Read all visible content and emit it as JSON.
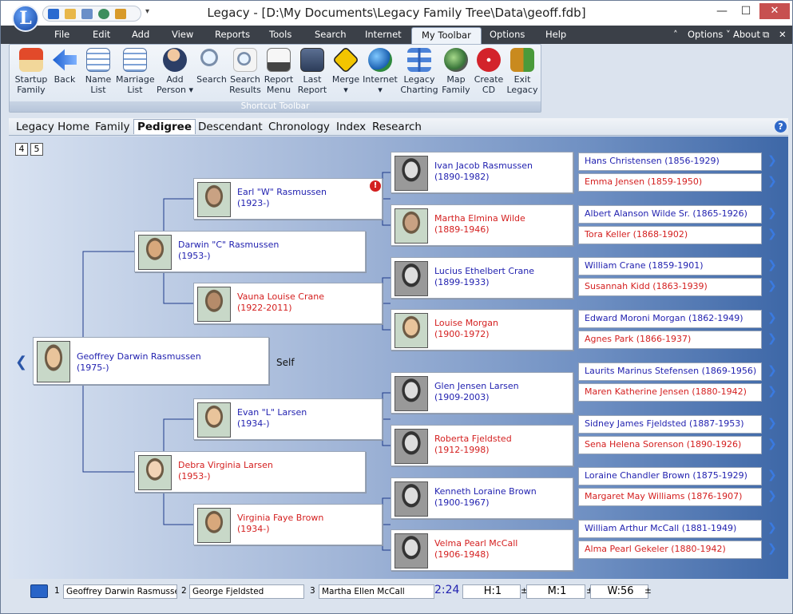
{
  "window": {
    "title": "Legacy - [D:\\My Documents\\Legacy Family Tree\\Data\\geoff.fdb]",
    "logo_letter": "L",
    "minimize": "—",
    "maximize": "☐",
    "close": "✕",
    "qat_more": "▾"
  },
  "menubar": {
    "items": [
      "File",
      "Edit",
      "Add",
      "View",
      "Reports",
      "Tools",
      "Search",
      "Internet",
      "My Toolbar",
      "Options",
      "Help"
    ],
    "right": {
      "chevron": "˄",
      "options": "Options ˅",
      "about": "About",
      "restore": "⧉",
      "close": "✕"
    }
  },
  "ribbon": {
    "buttons": [
      {
        "label": "Startup\nFamily",
        "icon": "house-icon"
      },
      {
        "label": "Back",
        "icon": "back-arrow-icon"
      },
      {
        "label": "Name\nList",
        "icon": "name-list-icon"
      },
      {
        "label": "Marriage\nList",
        "icon": "marriage-list-icon"
      },
      {
        "label": "Add\nPerson ▾",
        "icon": "add-person-icon"
      },
      {
        "label": "Search",
        "icon": "magnifier-icon"
      },
      {
        "label": "Search\nResults",
        "icon": "search-results-icon"
      },
      {
        "label": "Report\nMenu",
        "icon": "report-icon"
      },
      {
        "label": "Last\nReport",
        "icon": "last-report-icon"
      },
      {
        "label": "Merge\n▾",
        "icon": "merge-sign-icon"
      },
      {
        "label": "Internet\n▾",
        "icon": "globe-icon"
      },
      {
        "label": "Legacy\nCharting",
        "icon": "charting-icon"
      },
      {
        "label": "Map\nFamily",
        "icon": "map-icon"
      },
      {
        "label": "Create\nCD",
        "icon": "cd-icon"
      },
      {
        "label": "Exit\nLegacy",
        "icon": "exit-door-icon"
      }
    ],
    "group_label": "Shortcut Toolbar"
  },
  "tabs": [
    "Legacy Home",
    "Family",
    "Pedigree",
    "Descendant",
    "Chronology",
    "Index",
    "Research"
  ],
  "active_tab": "Pedigree",
  "generation_buttons": [
    "4",
    "5"
  ],
  "self_label": "Self",
  "people": {
    "p1": {
      "name": "Geoffrey Darwin Rasmussen",
      "dates": "(1975-)",
      "sex": "m"
    },
    "p2": {
      "name": "Darwin \"C\" Rasmussen",
      "dates": "(1953-)",
      "sex": "m"
    },
    "p3": {
      "name": "Debra Virginia Larsen",
      "dates": "(1953-)",
      "sex": "f"
    },
    "p4": {
      "name": "Earl \"W\" Rasmussen",
      "dates": "(1923-)",
      "sex": "m"
    },
    "p5": {
      "name": "Vauna Louise Crane",
      "dates": "(1922-2011)",
      "sex": "f"
    },
    "p6": {
      "name": "Evan \"L\" Larsen",
      "dates": "(1934-)",
      "sex": "m"
    },
    "p7": {
      "name": "Virginia Faye Brown",
      "dates": "(1934-)",
      "sex": "f"
    },
    "p8": {
      "name": "Ivan Jacob Rasmussen",
      "dates": "(1890-1982)",
      "sex": "m"
    },
    "p9": {
      "name": "Martha Elmina Wilde",
      "dates": "(1889-1946)",
      "sex": "f"
    },
    "p10": {
      "name": "Lucius Ethelbert Crane",
      "dates": "(1899-1933)",
      "sex": "m"
    },
    "p11": {
      "name": "Louise Morgan",
      "dates": "(1900-1972)",
      "sex": "f"
    },
    "p12": {
      "name": "Glen Jensen Larsen",
      "dates": "(1909-2003)",
      "sex": "m"
    },
    "p13": {
      "name": "Roberta Fjeldsted",
      "dates": "(1912-1998)",
      "sex": "f"
    },
    "p14": {
      "name": "Kenneth Loraine Brown",
      "dates": "(1900-1967)",
      "sex": "m"
    },
    "p15": {
      "name": "Velma Pearl McCall",
      "dates": "(1906-1948)",
      "sex": "f"
    }
  },
  "great_grandparents": [
    {
      "text": "Hans Christensen (1856-1929)",
      "sex": "m"
    },
    {
      "text": "Emma Jensen (1859-1950)",
      "sex": "f"
    },
    {
      "text": "Albert Alanson Wilde Sr. (1865-1926)",
      "sex": "m"
    },
    {
      "text": "Tora Keller (1868-1902)",
      "sex": "f"
    },
    {
      "text": "William Crane (1859-1901)",
      "sex": "m"
    },
    {
      "text": "Susannah Kidd (1863-1939)",
      "sex": "f"
    },
    {
      "text": "Edward Moroni Morgan (1862-1949)",
      "sex": "m"
    },
    {
      "text": "Agnes Park (1866-1937)",
      "sex": "f"
    },
    {
      "text": "Laurits Marinus Stefensen (1869-1956)",
      "sex": "m"
    },
    {
      "text": "Maren Katherine Jensen (1880-1942)",
      "sex": "f"
    },
    {
      "text": "Sidney James Fjeldsted (1887-1953)",
      "sex": "m"
    },
    {
      "text": "Sena Helena Sorenson (1890-1926)",
      "sex": "f"
    },
    {
      "text": "Loraine Chandler Brown (1875-1929)",
      "sex": "m"
    },
    {
      "text": "Margaret May Williams (1876-1907)",
      "sex": "f"
    },
    {
      "text": "William Arthur McCall (1881-1949)",
      "sex": "m"
    },
    {
      "text": "Alma Pearl Gekeler (1880-1942)",
      "sex": "f"
    }
  ],
  "warning_badge": "!",
  "nav_arrow": "❯",
  "nav_back": "❮",
  "status_bar": {
    "fields": [
      {
        "num": "1",
        "name": "Geoffrey Darwin Rasmussen"
      },
      {
        "num": "2",
        "name": "George Fjeldsted"
      },
      {
        "num": "3",
        "name": "Martha Ellen McCall"
      }
    ],
    "time": "2:24",
    "h": "H:1",
    "m": "M:1",
    "w": "W:56",
    "pm": "±"
  },
  "colors": {
    "male": "#2222b0",
    "female": "#d42020",
    "menubar": "#3b4048",
    "accent": "#3a7ae0"
  }
}
